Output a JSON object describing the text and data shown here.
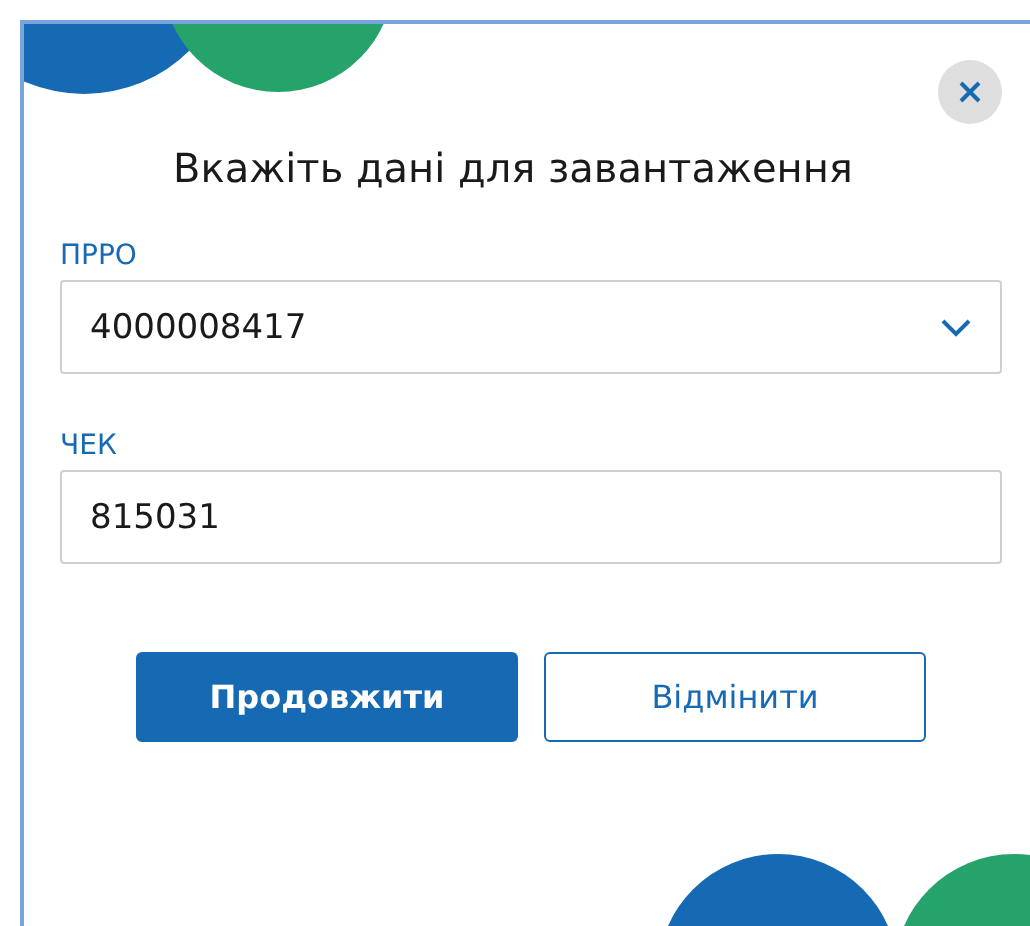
{
  "dialog": {
    "title": "Вкажіть дані для завантаження",
    "fields": [
      {
        "kind": "dropdown",
        "label": "ПРРО",
        "value": "4000008417"
      },
      {
        "kind": "text",
        "label": "ЧЕК",
        "value": "815031"
      }
    ],
    "buttons": [
      {
        "kind": "primary",
        "label": "Продовжити"
      },
      {
        "kind": "secondary",
        "label": "Відмінити"
      }
    ]
  }
}
